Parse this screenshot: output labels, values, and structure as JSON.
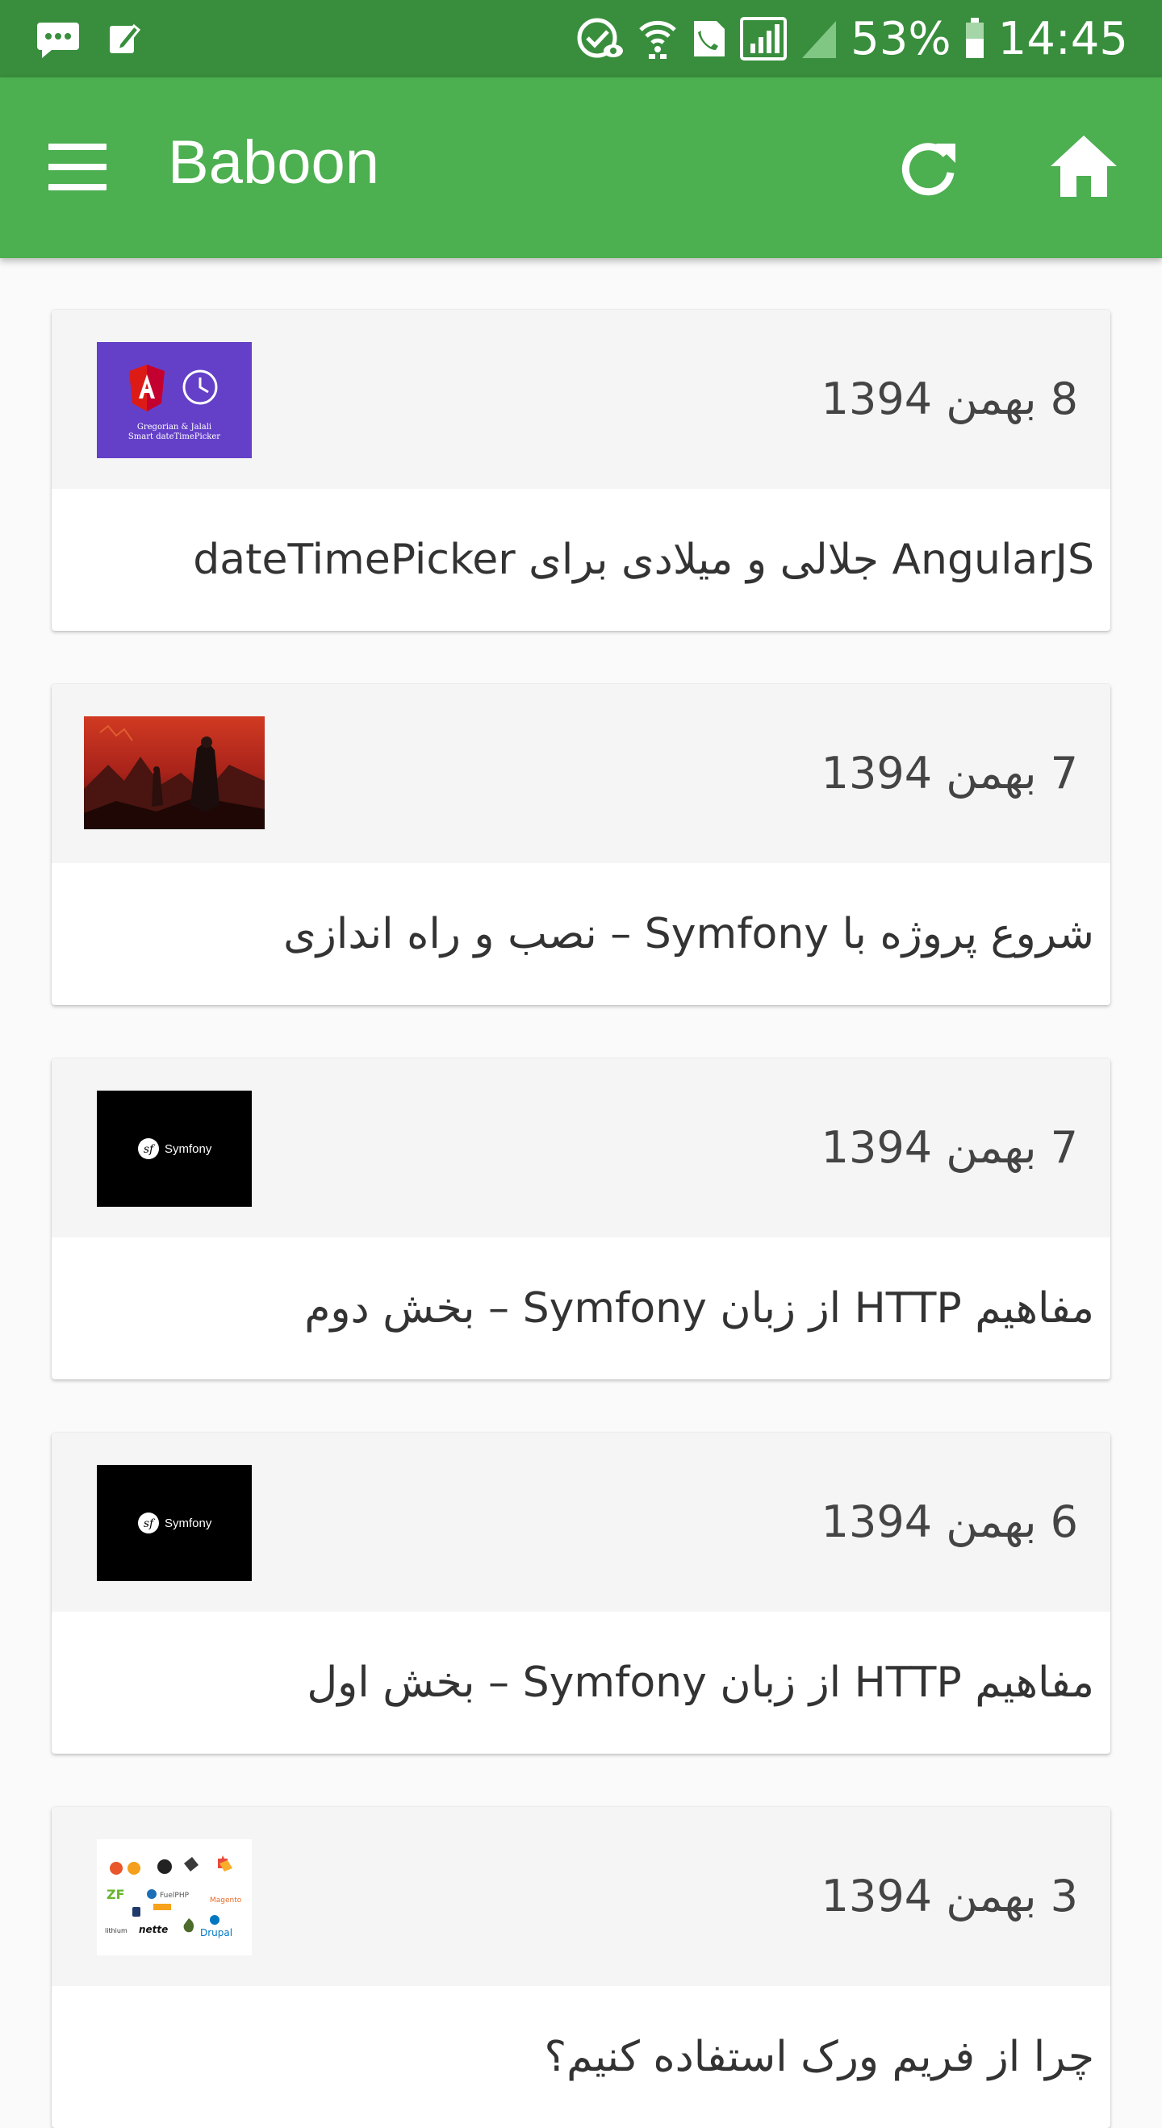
{
  "status_bar": {
    "battery_percent": "53%",
    "time": "14:45",
    "icons": [
      "message-icon",
      "edit-icon",
      "eye-check-icon",
      "wifi-icon",
      "call-icon",
      "signal-icon",
      "signal-empty-icon",
      "battery-icon"
    ],
    "color": "#388e3c"
  },
  "app_bar": {
    "title": "Baboon",
    "color": "#4caf50",
    "menu_icon": "menu-icon",
    "refresh_icon": "refresh-icon",
    "home_icon": "home-icon"
  },
  "posts": [
    {
      "date": "8 بهمن 1394",
      "title": "AngularJS جلالی و میلادی برای dateTimePicker",
      "thumb": "angular-datepicker-thumbnail",
      "thumb_text": [
        "Gregorian & Jalali",
        "Smart dateTimePicker"
      ]
    },
    {
      "date": "7 بهمن 1394",
      "title": "شروع پروژه با Symfony – نصب و راه اندازی",
      "thumb": "fiery-landscape-thumbnail"
    },
    {
      "date": "7 بهمن 1394",
      "title": "مفاهیم HTTP از زبان Symfony – بخش دوم",
      "thumb": "symfony-logo-thumbnail",
      "thumb_text": "Symfony"
    },
    {
      "date": "6 بهمن 1394",
      "title": "مفاهیم HTTP از زبان Symfony – بخش اول",
      "thumb": "symfony-logo-thumbnail",
      "thumb_text": "Symfony"
    },
    {
      "date": "3 بهمن 1394",
      "title": "چرا از فریم ورک استفاده کنیم؟",
      "thumb": "frameworks-logos-thumbnail"
    }
  ]
}
